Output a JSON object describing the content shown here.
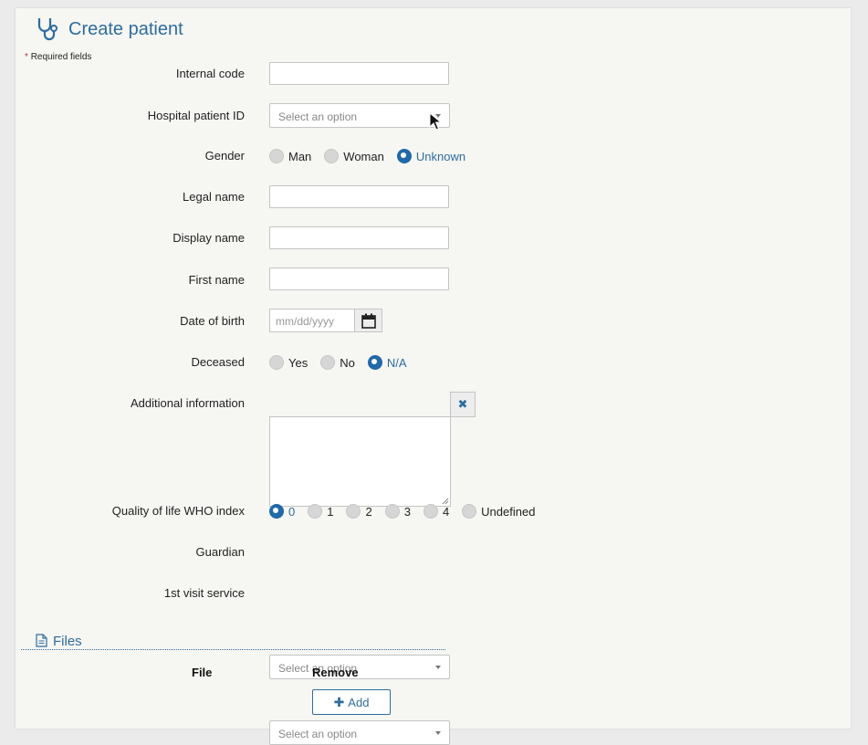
{
  "header": {
    "title": "Create patient",
    "required_note": "Required fields",
    "required_star": "*",
    "icon": "stethoscope-icon"
  },
  "form": {
    "internal_code": {
      "label": "Internal code",
      "value": ""
    },
    "hospital_patient_id": {
      "label": "Hospital patient ID",
      "placeholder": "Select an option"
    },
    "gender": {
      "label": "Gender",
      "options": [
        "Man",
        "Woman",
        "Unknown"
      ],
      "selected": "Unknown"
    },
    "legal_name": {
      "label": "Legal name",
      "value": ""
    },
    "display_name": {
      "label": "Display name",
      "value": ""
    },
    "first_name": {
      "label": "First name",
      "value": ""
    },
    "date_of_birth": {
      "label": "Date of birth",
      "placeholder": "mm/dd/yyyy"
    },
    "deceased": {
      "label": "Deceased",
      "options": [
        "Yes",
        "No",
        "N/A"
      ],
      "selected": "N/A"
    },
    "additional_information": {
      "label": "Additional information",
      "value": ""
    },
    "qol_who_index": {
      "label": "Quality of life WHO index",
      "options": [
        "0",
        "1",
        "2",
        "3",
        "4",
        "Undefined"
      ],
      "selected": "0"
    },
    "guardian": {
      "label": "Guardian",
      "placeholder": "Select an option"
    },
    "first_visit_service": {
      "label": "1st visit service",
      "placeholder": "Select an option"
    }
  },
  "files": {
    "title": "Files",
    "columns": [
      "File",
      "Remove"
    ],
    "add_label": "Add"
  },
  "colors": {
    "accent": "#2e6d9e",
    "radio_checked": "#2169a8",
    "panel_bg": "#f6f6f3"
  }
}
